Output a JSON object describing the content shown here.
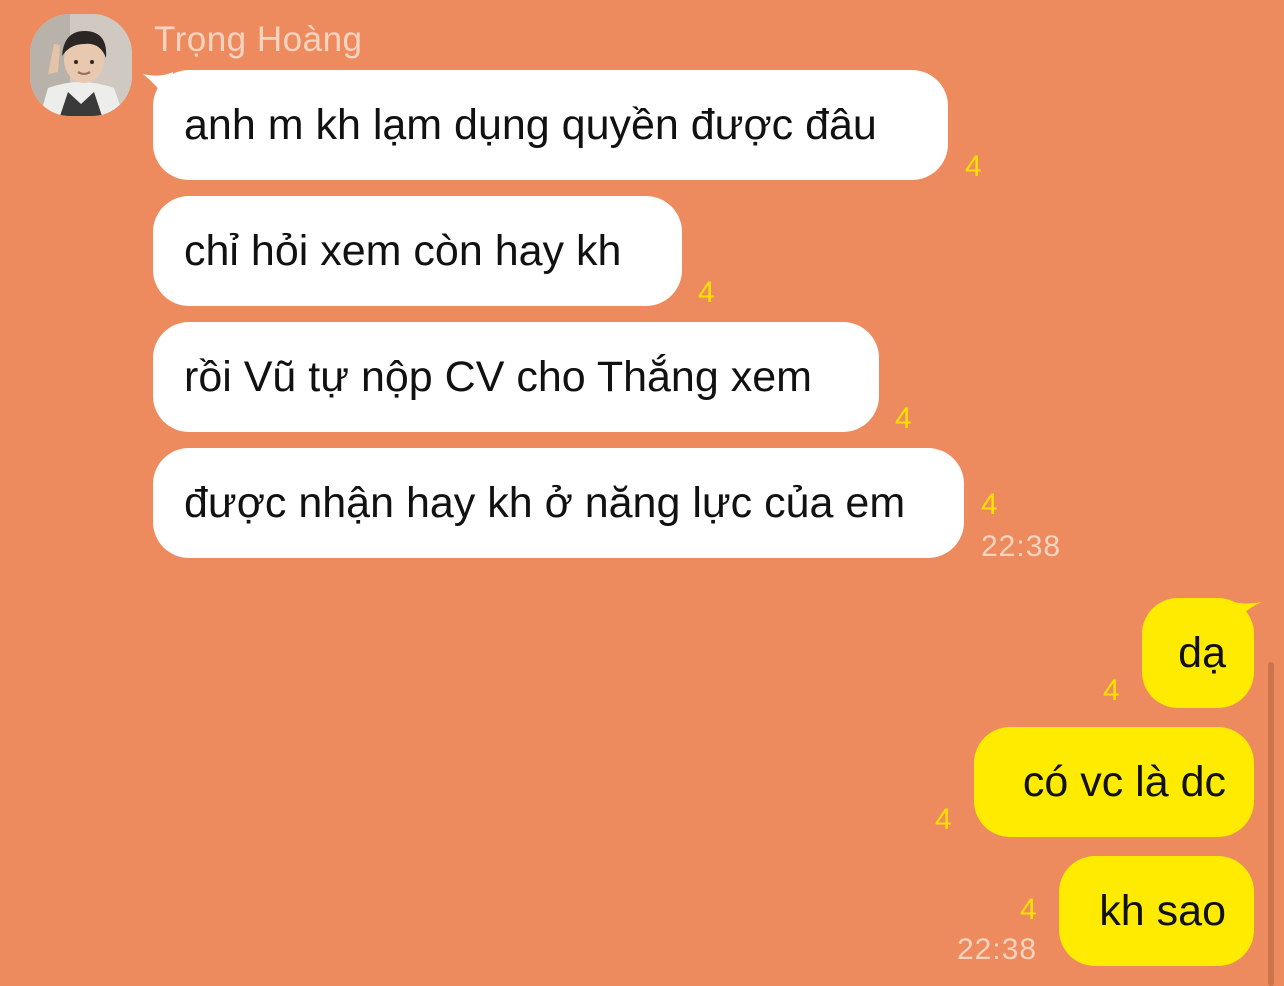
{
  "contact": {
    "name": "Trọng Hoàng"
  },
  "incoming": [
    {
      "text": "anh m kh lạm dụng quyền được đâu",
      "unread": "4"
    },
    {
      "text": "chỉ hỏi xem còn hay kh",
      "unread": "4"
    },
    {
      "text": "rồi Vũ tự nộp CV cho Thắng xem",
      "unread": "4"
    },
    {
      "text": "được nhận hay kh ở năng lực của em",
      "unread": "4",
      "time": "22:38"
    }
  ],
  "outgoing": [
    {
      "text": "dạ",
      "unread": "4"
    },
    {
      "text": "có vc là dc",
      "unread": "4"
    },
    {
      "text": "kh sao",
      "unread": "4",
      "time": "22:38"
    }
  ],
  "colors": {
    "background": "#ee8b5e",
    "incoming_bubble": "#ffffff",
    "outgoing_bubble": "#ffeb00",
    "unread_count": "#ffe000",
    "meta_text": "#f7d4bf"
  }
}
